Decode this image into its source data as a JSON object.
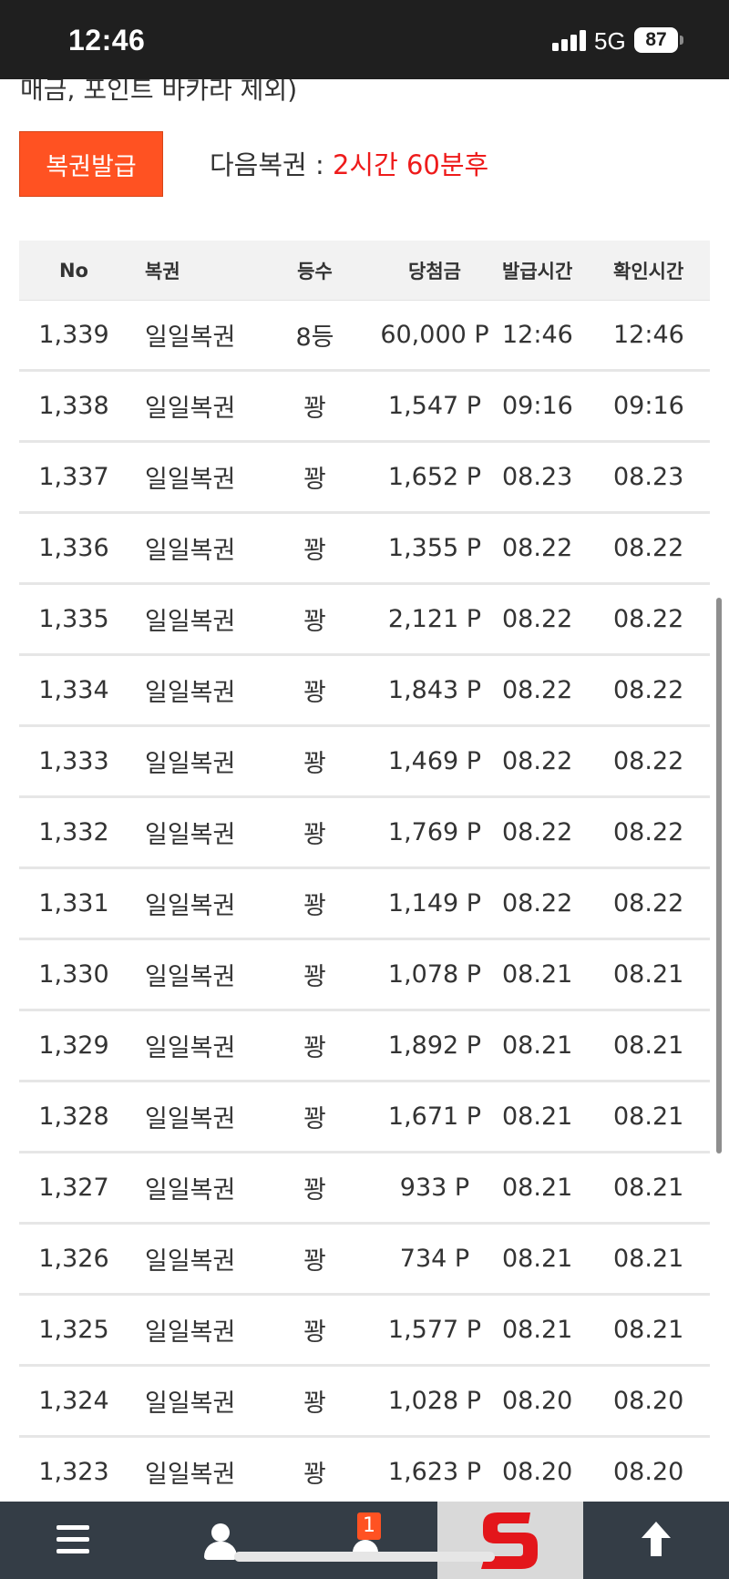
{
  "status_bar": {
    "time": "12:46",
    "network": "5G",
    "battery": "87",
    "icons": [
      "signal-icon",
      "battery-icon"
    ]
  },
  "header": {
    "partial_text": "매금, 포인트 바카라 제외)"
  },
  "lottery": {
    "issue_button_label": "복권발급",
    "next_label": "다음복권 :",
    "next_time": "2시간 60분후",
    "colors": {
      "button": "#ff5222",
      "highlight": "#ee1b1b"
    }
  },
  "table": {
    "columns": [
      "No",
      "복권",
      "등수",
      "당첨금",
      "발급시간",
      "확인시간"
    ],
    "rows": [
      [
        "1,339",
        "일일복권",
        "8등",
        "60,000 P",
        "12:46",
        "12:46"
      ],
      [
        "1,338",
        "일일복권",
        "꽝",
        "1,547 P",
        "09:16",
        "09:16"
      ],
      [
        "1,337",
        "일일복권",
        "꽝",
        "1,652 P",
        "08.23",
        "08.23"
      ],
      [
        "1,336",
        "일일복권",
        "꽝",
        "1,355 P",
        "08.22",
        "08.22"
      ],
      [
        "1,335",
        "일일복권",
        "꽝",
        "2,121 P",
        "08.22",
        "08.22"
      ],
      [
        "1,334",
        "일일복권",
        "꽝",
        "1,843 P",
        "08.22",
        "08.22"
      ],
      [
        "1,333",
        "일일복권",
        "꽝",
        "1,469 P",
        "08.22",
        "08.22"
      ],
      [
        "1,332",
        "일일복권",
        "꽝",
        "1,769 P",
        "08.22",
        "08.22"
      ],
      [
        "1,331",
        "일일복권",
        "꽝",
        "1,149 P",
        "08.22",
        "08.22"
      ],
      [
        "1,330",
        "일일복권",
        "꽝",
        "1,078 P",
        "08.21",
        "08.21"
      ],
      [
        "1,329",
        "일일복권",
        "꽝",
        "1,892 P",
        "08.21",
        "08.21"
      ],
      [
        "1,328",
        "일일복권",
        "꽝",
        "1,671 P",
        "08.21",
        "08.21"
      ],
      [
        "1,327",
        "일일복권",
        "꽝",
        "933 P",
        "08.21",
        "08.21"
      ],
      [
        "1,326",
        "일일복권",
        "꽝",
        "734 P",
        "08.21",
        "08.21"
      ],
      [
        "1,325",
        "일일복권",
        "꽝",
        "1,577 P",
        "08.21",
        "08.21"
      ],
      [
        "1,324",
        "일일복권",
        "꽝",
        "1,028 P",
        "08.20",
        "08.20"
      ],
      [
        "1,323",
        "일일복권",
        "꽝",
        "1,623 P",
        "08.20",
        "08.20"
      ]
    ]
  },
  "bottom_nav": {
    "notification_count": "1",
    "icons": [
      "menu-icon",
      "user-icon",
      "bell-icon",
      "site-logo-icon",
      "arrow-up-icon"
    ],
    "colors": {
      "bar": "#343d46",
      "logo_bg": "#d9d9d9",
      "logo": "#e3161b"
    }
  }
}
